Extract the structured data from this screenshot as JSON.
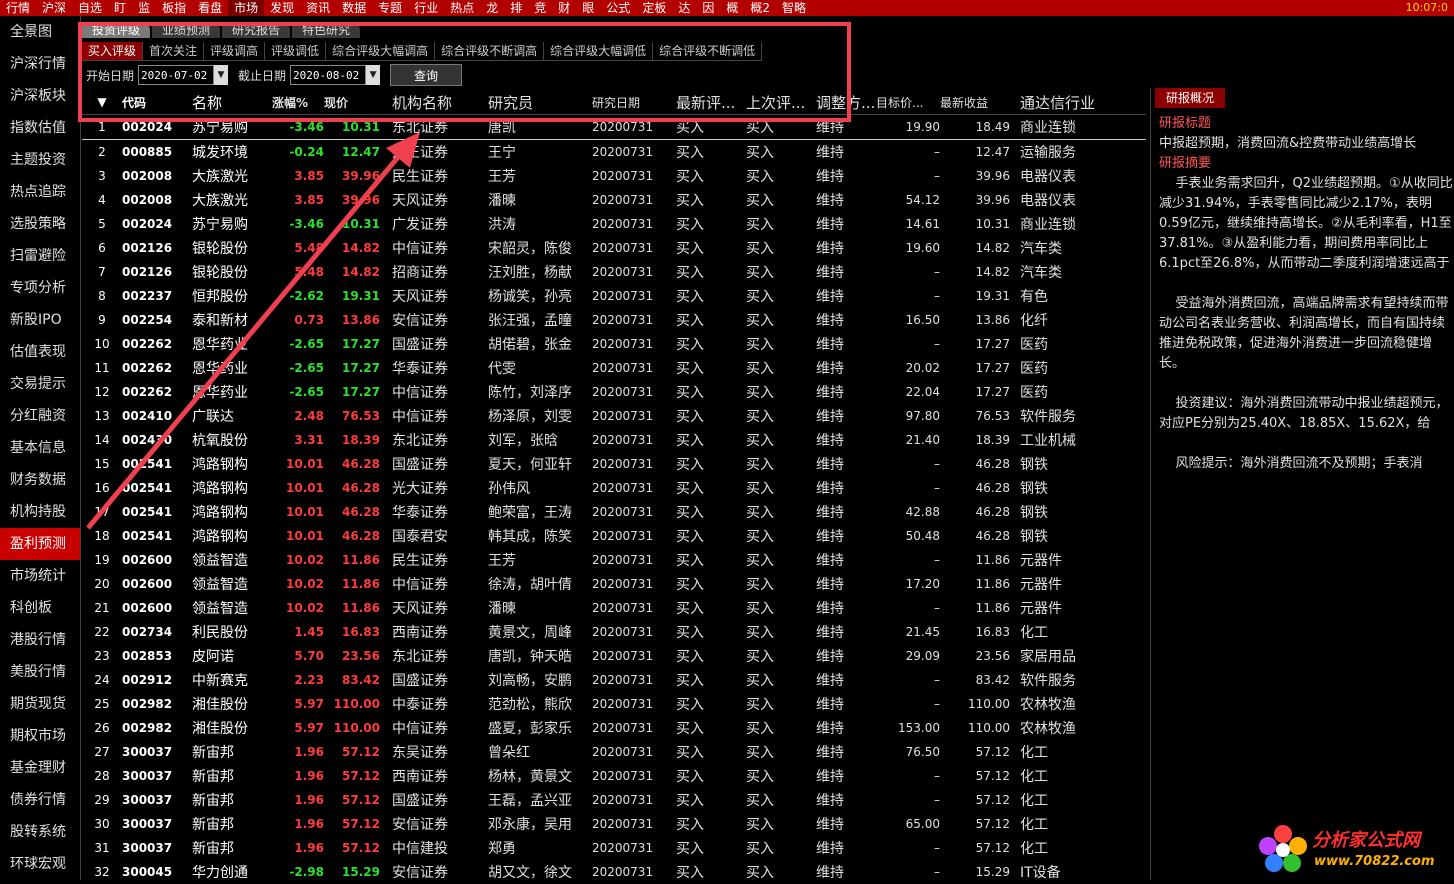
{
  "topbar": {
    "menu": [
      "行情",
      "沪深",
      "自选",
      "盯",
      "监",
      "板指",
      "看盘",
      "市场",
      "发现",
      "资讯",
      "数据",
      "专题",
      "行业",
      "热点",
      "龙",
      "排",
      "竞",
      "财",
      "眼",
      "公式",
      "定板",
      "达",
      "因",
      "概",
      "概2",
      "智略"
    ],
    "active_index": 7,
    "clock": "10:07:0"
  },
  "sidebar": {
    "items": [
      "全景图",
      "沪深行情",
      "沪深板块",
      "指数估值",
      "主题投资",
      "热点追踪",
      "选股策略",
      "扫雷避险",
      "专项分析",
      "新股IPO",
      "估值表现",
      "交易提示",
      "分红融资",
      "基本信息",
      "财务数据",
      "机构持股",
      "盈利预测",
      "市场统计",
      "科创板",
      "港股行情",
      "美股行情",
      "期货现货",
      "期权市场",
      "基金理财",
      "债券行情",
      "股转系统",
      "环球宏观"
    ],
    "active_index": 16
  },
  "tabs_main": [
    "投资评级",
    "业绩预测",
    "研究报告",
    "特色研究"
  ],
  "tabs_sub": [
    "买入评级",
    "首次关注",
    "评级调高",
    "评级调低",
    "综合评级大幅调高",
    "综合评级不断调高",
    "综合评级大幅调低",
    "综合评级不断调低"
  ],
  "filter": {
    "start_label": "开始日期",
    "start_value": "2020-07-02",
    "end_label": "截止日期",
    "end_value": "2020-08-02",
    "query_label": "查询"
  },
  "table": {
    "sort_glyph": "▼",
    "columns": [
      "代码",
      "名称",
      "涨幅%",
      "现价",
      "机构名称",
      "研究员",
      "研究日期",
      "最新评...",
      "上次评...",
      "调整方...",
      "目标价...",
      "最新收益",
      "通达信行业"
    ],
    "rows": [
      [
        "1",
        "002024",
        "苏宁易购",
        "-3.46",
        "10.31",
        "东北证券",
        "唐凯",
        "20200731",
        "买入",
        "买入",
        "维持",
        "19.90",
        "18.49",
        "商业连锁"
      ],
      [
        "2",
        "000885",
        "城发环境",
        "-0.24",
        "12.47",
        "方正证券",
        "王宁",
        "20200731",
        "买入",
        "买入",
        "维持",
        "–",
        "12.47",
        "运输服务"
      ],
      [
        "3",
        "002008",
        "大族激光",
        "3.85",
        "39.96",
        "民生证券",
        "王芳",
        "20200731",
        "买入",
        "买入",
        "维持",
        "–",
        "39.96",
        "电器仪表"
      ],
      [
        "4",
        "002008",
        "大族激光",
        "3.85",
        "39.96",
        "天风证券",
        "潘暕",
        "20200731",
        "买入",
        "买入",
        "维持",
        "54.12",
        "39.96",
        "电器仪表"
      ],
      [
        "5",
        "002024",
        "苏宁易购",
        "-3.46",
        "10.31",
        "广发证券",
        "洪涛",
        "20200731",
        "买入",
        "买入",
        "维持",
        "14.61",
        "10.31",
        "商业连锁"
      ],
      [
        "6",
        "002126",
        "银轮股份",
        "5.48",
        "14.82",
        "中信证券",
        "宋韶灵，陈俊",
        "20200731",
        "买入",
        "买入",
        "维持",
        "19.60",
        "14.82",
        "汽车类"
      ],
      [
        "7",
        "002126",
        "银轮股份",
        "5.48",
        "14.82",
        "招商证券",
        "汪刘胜，杨献",
        "20200731",
        "买入",
        "买入",
        "维持",
        "–",
        "14.82",
        "汽车类"
      ],
      [
        "8",
        "002237",
        "恒邦股份",
        "-2.62",
        "19.31",
        "天风证券",
        "杨诚笑，孙亮",
        "20200731",
        "买入",
        "买入",
        "维持",
        "–",
        "19.31",
        "有色"
      ],
      [
        "9",
        "002254",
        "泰和新材",
        "0.73",
        "13.86",
        "安信证券",
        "张汪强，孟曈",
        "20200731",
        "买入",
        "买入",
        "维持",
        "16.50",
        "13.86",
        "化纤"
      ],
      [
        "10",
        "002262",
        "恩华药业",
        "-2.65",
        "17.27",
        "国盛证券",
        "胡偌碧，张金",
        "20200731",
        "买入",
        "买入",
        "维持",
        "–",
        "17.27",
        "医药"
      ],
      [
        "11",
        "002262",
        "恩华药业",
        "-2.65",
        "17.27",
        "华泰证券",
        "代雯",
        "20200731",
        "买入",
        "买入",
        "维持",
        "20.02",
        "17.27",
        "医药"
      ],
      [
        "12",
        "002262",
        "恩华药业",
        "-2.65",
        "17.27",
        "中信证券",
        "陈竹，刘泽序",
        "20200731",
        "买入",
        "买入",
        "维持",
        "22.04",
        "17.27",
        "医药"
      ],
      [
        "13",
        "002410",
        "广联达",
        "2.48",
        "76.53",
        "中信证券",
        "杨泽原，刘雯",
        "20200731",
        "买入",
        "买入",
        "维持",
        "97.80",
        "76.53",
        "软件服务"
      ],
      [
        "14",
        "002430",
        "杭氧股份",
        "3.31",
        "18.39",
        "东北证券",
        "刘军，张晗",
        "20200731",
        "买入",
        "买入",
        "维持",
        "21.40",
        "18.39",
        "工业机械"
      ],
      [
        "15",
        "002541",
        "鸿路钢构",
        "10.01",
        "46.28",
        "国盛证券",
        "夏天，何亚轩",
        "20200731",
        "买入",
        "买入",
        "维持",
        "–",
        "46.28",
        "钢铁"
      ],
      [
        "16",
        "002541",
        "鸿路钢构",
        "10.01",
        "46.28",
        "光大证券",
        "孙伟风",
        "20200731",
        "买入",
        "买入",
        "维持",
        "–",
        "46.28",
        "钢铁"
      ],
      [
        "17",
        "002541",
        "鸿路钢构",
        "10.01",
        "46.28",
        "华泰证券",
        "鲍荣富，王涛",
        "20200731",
        "买入",
        "买入",
        "维持",
        "42.88",
        "46.28",
        "钢铁"
      ],
      [
        "18",
        "002541",
        "鸿路钢构",
        "10.01",
        "46.28",
        "国泰君安",
        "韩其成，陈笑",
        "20200731",
        "买入",
        "买入",
        "维持",
        "50.48",
        "46.28",
        "钢铁"
      ],
      [
        "19",
        "002600",
        "领益智造",
        "10.02",
        "11.86",
        "民生证券",
        "王芳",
        "20200731",
        "买入",
        "买入",
        "维持",
        "–",
        "11.86",
        "元器件"
      ],
      [
        "20",
        "002600",
        "领益智造",
        "10.02",
        "11.86",
        "中信证券",
        "徐涛，胡叶倩",
        "20200731",
        "买入",
        "买入",
        "维持",
        "17.20",
        "11.86",
        "元器件"
      ],
      [
        "21",
        "002600",
        "领益智造",
        "10.02",
        "11.86",
        "天风证券",
        "潘暕",
        "20200731",
        "买入",
        "买入",
        "维持",
        "–",
        "11.86",
        "元器件"
      ],
      [
        "22",
        "002734",
        "利民股份",
        "1.45",
        "16.83",
        "西南证券",
        "黄景文，周峰",
        "20200731",
        "买入",
        "买入",
        "维持",
        "21.45",
        "16.83",
        "化工"
      ],
      [
        "23",
        "002853",
        "皮阿诺",
        "5.70",
        "23.56",
        "东北证券",
        "唐凯，钟天皓",
        "20200731",
        "买入",
        "买入",
        "维持",
        "29.09",
        "23.56",
        "家居用品"
      ],
      [
        "24",
        "002912",
        "中新赛克",
        "2.23",
        "83.42",
        "国盛证券",
        "刘高畅，安鹏",
        "20200731",
        "买入",
        "买入",
        "维持",
        "–",
        "83.42",
        "软件服务"
      ],
      [
        "25",
        "002982",
        "湘佳股份",
        "5.97",
        "110.00",
        "中泰证券",
        "范劲松，熊欣",
        "20200731",
        "买入",
        "买入",
        "维持",
        "–",
        "110.00",
        "农林牧渔"
      ],
      [
        "26",
        "002982",
        "湘佳股份",
        "5.97",
        "110.00",
        "中信证券",
        "盛夏，彭家乐",
        "20200731",
        "买入",
        "买入",
        "维持",
        "153.00",
        "110.00",
        "农林牧渔"
      ],
      [
        "27",
        "300037",
        "新宙邦",
        "1.96",
        "57.12",
        "东吴证券",
        "曾朵红",
        "20200731",
        "买入",
        "买入",
        "维持",
        "76.50",
        "57.12",
        "化工"
      ],
      [
        "28",
        "300037",
        "新宙邦",
        "1.96",
        "57.12",
        "西南证券",
        "杨林，黄景文",
        "20200731",
        "买入",
        "买入",
        "维持",
        "–",
        "57.12",
        "化工"
      ],
      [
        "29",
        "300037",
        "新宙邦",
        "1.96",
        "57.12",
        "国盛证券",
        "王磊，孟兴亚",
        "20200731",
        "买入",
        "买入",
        "维持",
        "–",
        "57.12",
        "化工"
      ],
      [
        "30",
        "300037",
        "新宙邦",
        "1.96",
        "57.12",
        "安信证券",
        "邓永康，吴用",
        "20200731",
        "买入",
        "买入",
        "维持",
        "65.00",
        "57.12",
        "化工"
      ],
      [
        "31",
        "300037",
        "新宙邦",
        "1.96",
        "57.12",
        "中信建投",
        "郑勇",
        "20200731",
        "买入",
        "买入",
        "维持",
        "–",
        "57.12",
        "化工"
      ],
      [
        "32",
        "300045",
        "华力创通",
        "-2.98",
        "15.29",
        "安信证券",
        "胡又文，徐文",
        "20200731",
        "买入",
        "买入",
        "维持",
        "–",
        "15.29",
        "IT设备"
      ]
    ]
  },
  "right_panel": {
    "tab": "研报概况",
    "title_head": "研报标题",
    "title": "中报超预期，消费回流&控费带动业绩高增长",
    "summary_head": "研报摘要",
    "paragraphs": [
      "    手表业务需求回升，Q2业绩超预期。①从收同比减少31.94%，手表零售同比减少2.17%，表明0.59亿元，继续维持高增长。②从毛利率看，H1至37.81%。③从盈利能力看，期间费用率同比上6.1pct至26.8%，从而带动二季度利润增速远高于",
      "    受益海外消费回流，高端品牌需求有望持续而带动公司名表业务营收、利润高增长，而自有国持续推进免税政策，促进海外消费进一步回流稳健增长。",
      "    投资建议：海外消费回流带动中报业绩超预元，对应PE分别为25.40X、18.85X、15.62X，给",
      "    风险提示：海外消费回流不及预期；手表消"
    ]
  },
  "watermark": {
    "text1": "分析家公式网",
    "text2": "www.70822.com"
  },
  "colors": {
    "accent_red": "#c80000",
    "annotation_red": "#f04050",
    "up": "#ff3c3c",
    "down": "#2ee02e"
  }
}
